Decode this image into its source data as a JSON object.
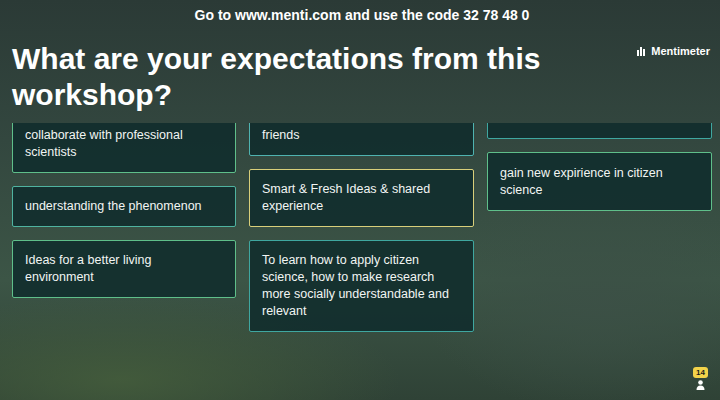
{
  "header": {
    "before": "Go to ",
    "url": "www.menti.com",
    "middle": " and use the code ",
    "code": "32 78 48 0"
  },
  "title": "What are your expectations from this workshop?",
  "logo": "Mentimeter",
  "columns": [
    [
      {
        "text": "collaborate with professional scientists",
        "color": "#5fbf8a"
      },
      {
        "text": "understanding the phenomenon",
        "color": "#4fb3a0"
      },
      {
        "text": "Ideas for a better living environment",
        "color": "#5fbf8a"
      }
    ],
    [
      {
        "text": "friends",
        "color": "#4fb3b0"
      },
      {
        "text": "Smart & Fresh Ideas & shared experience",
        "color": "#d9cf7a"
      },
      {
        "text": "To learn how to apply citizen science, how to make research more socially understandable and relevant",
        "color": "#3fa7a0"
      }
    ],
    [
      {
        "text": "",
        "color": "#3fa7a0"
      },
      {
        "text": "gain new expirience in citizen science",
        "color": "#5fbf8a"
      }
    ]
  ],
  "participants": {
    "count": "14"
  }
}
